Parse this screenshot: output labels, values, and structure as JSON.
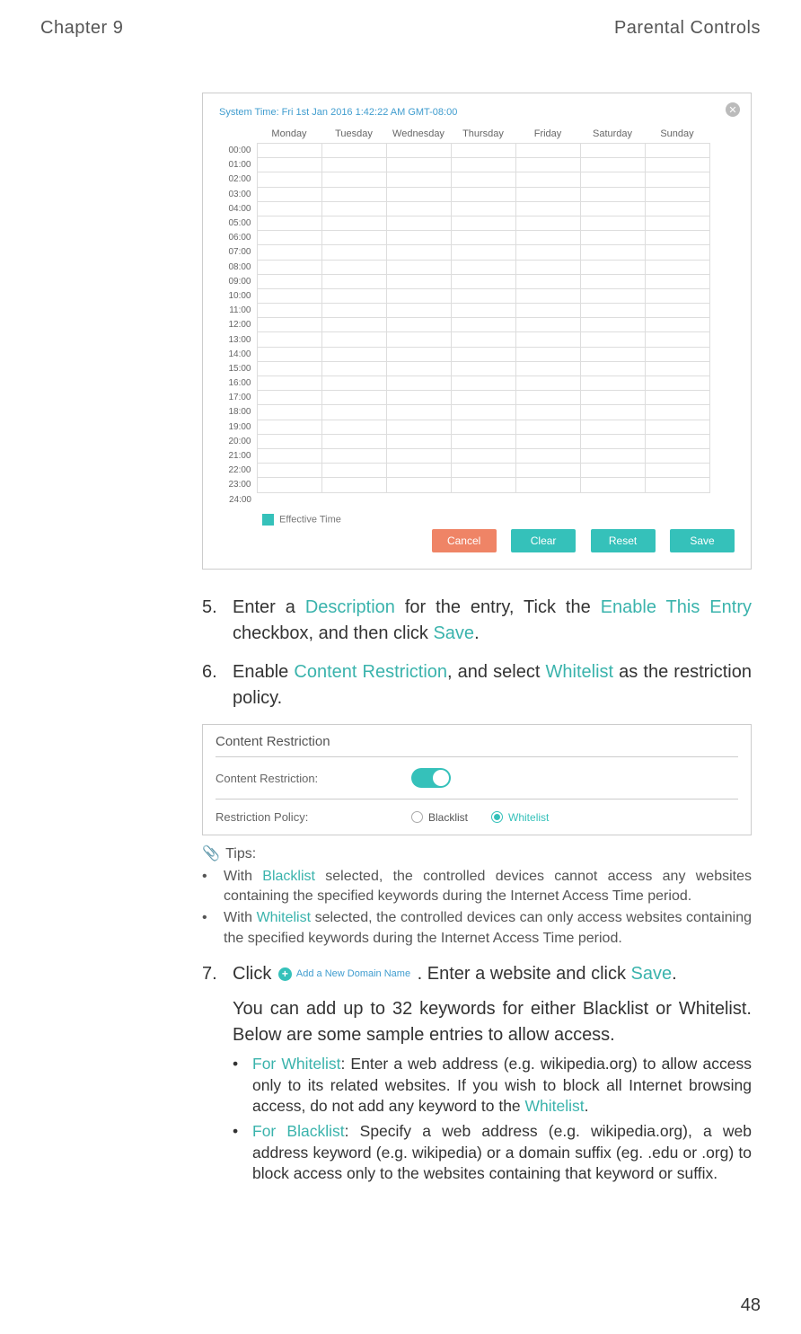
{
  "header": {
    "chapter": "Chapter 9",
    "title": "Parental Controls"
  },
  "page_number": "48",
  "schedule": {
    "system_time": "System Time: Fri 1st Jan 2016 1:42:22 AM GMT-08:00",
    "days": [
      "Monday",
      "Tuesday",
      "Wednesday",
      "Thursday",
      "Friday",
      "Saturday",
      "Sunday"
    ],
    "hours": [
      "00:00",
      "01:00",
      "02:00",
      "03:00",
      "04:00",
      "05:00",
      "06:00",
      "07:00",
      "08:00",
      "09:00",
      "10:00",
      "11:00",
      "12:00",
      "13:00",
      "14:00",
      "15:00",
      "16:00",
      "17:00",
      "18:00",
      "19:00",
      "20:00",
      "21:00",
      "22:00",
      "23:00",
      "24:00"
    ],
    "legend": "Effective Time",
    "buttons": {
      "cancel": "Cancel",
      "clear": "Clear",
      "reset": "Reset",
      "save": "Save"
    }
  },
  "steps": {
    "s5": {
      "num": "5.",
      "t1": "Enter a ",
      "teal1": "Description",
      "t2": " for the entry, Tick the ",
      "teal2": "Enable This Entry",
      "t3": " checkbox, and then click ",
      "teal3": "Save",
      "t4": "."
    },
    "s6": {
      "num": "6.",
      "t1": "Enable ",
      "teal1": "Content Restriction",
      "t2": ", and select ",
      "teal2": "Whitelist",
      "t3": " as the restriction policy."
    },
    "s7": {
      "num": "7.",
      "t1": "Click ",
      "btn_label": "Add a New Domain Name",
      "t2": ". Enter a website and click ",
      "teal1": "Save",
      "t3": ".",
      "para1": "You can add up to 32 keywords for either Blacklist or Whitelist. Below are some sample entries to allow access.",
      "wl": {
        "teal": "For Whitelist",
        "rest": ": Enter a web address (e.g. wikipedia.org) to allow access only to its related websites. If you wish to block all Internet browsing access, do not add any keyword to the ",
        "teal2": "Whitelist",
        "end": "."
      },
      "bl": {
        "teal": "For Blacklist",
        "rest": ": Specify a web address (e.g. wikipedia.org), a web address keyword (e.g. wikipedia) or a domain suffix (eg. .edu or .org) to block access only to the websites containing that keyword or suffix."
      }
    }
  },
  "cr": {
    "title": "Content Restriction",
    "row1_label": "Content Restriction:",
    "row2_label": "Restriction Policy:",
    "blacklist": "Blacklist",
    "whitelist": "Whitelist"
  },
  "tips": {
    "title": "Tips:",
    "li1": {
      "a": "With ",
      "teal": "Blacklist",
      "b": " selected, the controlled devices cannot access any websites containing the specified keywords during the Internet Access Time period."
    },
    "li2": {
      "a": "With ",
      "teal": "Whitelist",
      "b": " selected, the controlled devices can only access websites containing the specified keywords during the Internet Access Time period."
    }
  }
}
